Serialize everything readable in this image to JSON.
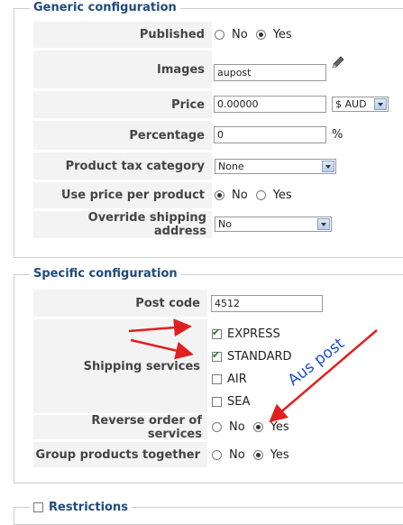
{
  "generic": {
    "legend": "Generic configuration",
    "published": {
      "label": "Published",
      "no": "No",
      "yes": "Yes",
      "selected": "Yes"
    },
    "images": {
      "label": "Images",
      "value": "aupost",
      "icon": "pencil-icon"
    },
    "price": {
      "label": "Price",
      "value": "0.00000",
      "currency": "$ AUD"
    },
    "percentage": {
      "label": "Percentage",
      "value": "0",
      "unit": "%"
    },
    "tax": {
      "label": "Product tax category",
      "value": "None"
    },
    "use_price": {
      "label": "Use price per product",
      "no": "No",
      "yes": "Yes",
      "selected": "No"
    },
    "override": {
      "label": "Override shipping address",
      "value": "No"
    }
  },
  "specific": {
    "legend": "Specific configuration",
    "postcode": {
      "label": "Post code",
      "value": "4512"
    },
    "shipping": {
      "label": "Shipping services",
      "options": [
        {
          "label": "EXPRESS",
          "checked": true
        },
        {
          "label": "STANDARD",
          "checked": true
        },
        {
          "label": "AIR",
          "checked": false
        },
        {
          "label": "SEA",
          "checked": false
        }
      ]
    },
    "reverse": {
      "label": "Reverse order of services",
      "no": "No",
      "yes": "Yes",
      "selected": "Yes"
    },
    "group": {
      "label": "Group products together",
      "no": "No",
      "yes": "Yes",
      "selected": "Yes"
    }
  },
  "restrictions": {
    "legend": "Restrictions"
  },
  "annotation": {
    "text": "Aus post",
    "color": "#e02020",
    "text_color": "#1f4fcf"
  }
}
